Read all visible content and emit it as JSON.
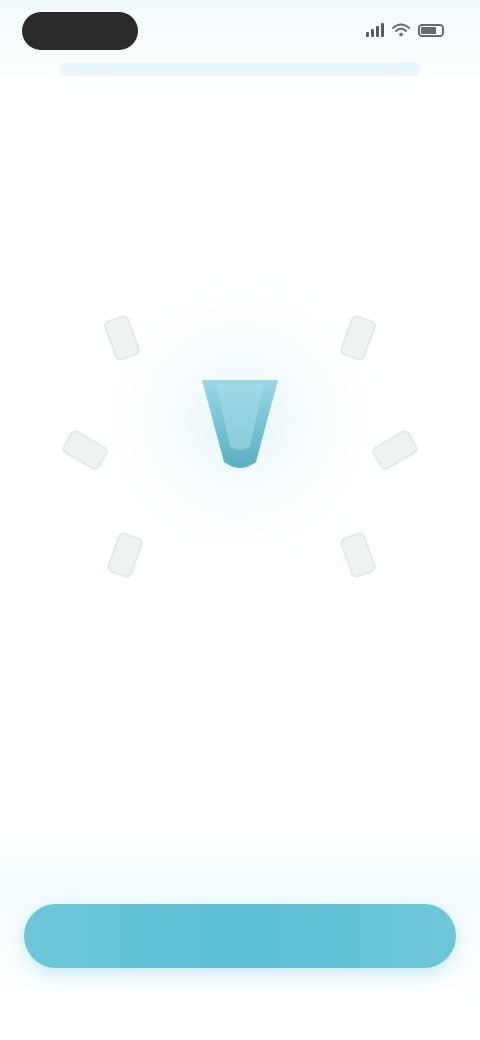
{
  "status_bar": {
    "time": "",
    "pill_color": "#2b2b2b"
  },
  "header": {
    "title": ""
  },
  "graphic": {
    "center_icon": "phone-tilt-icon",
    "around_icons": [
      "tilt-up-left-icon",
      "tilt-up-right-icon",
      "tilt-left-icon",
      "tilt-right-icon",
      "tilt-down-left-icon",
      "tilt-down-right-icon"
    ],
    "accent_color": "#5cbfd4"
  },
  "instruction": {
    "text": ""
  },
  "actions": {
    "skip_label": "",
    "primary_label": "",
    "primary_color": "#5cbfd4"
  }
}
